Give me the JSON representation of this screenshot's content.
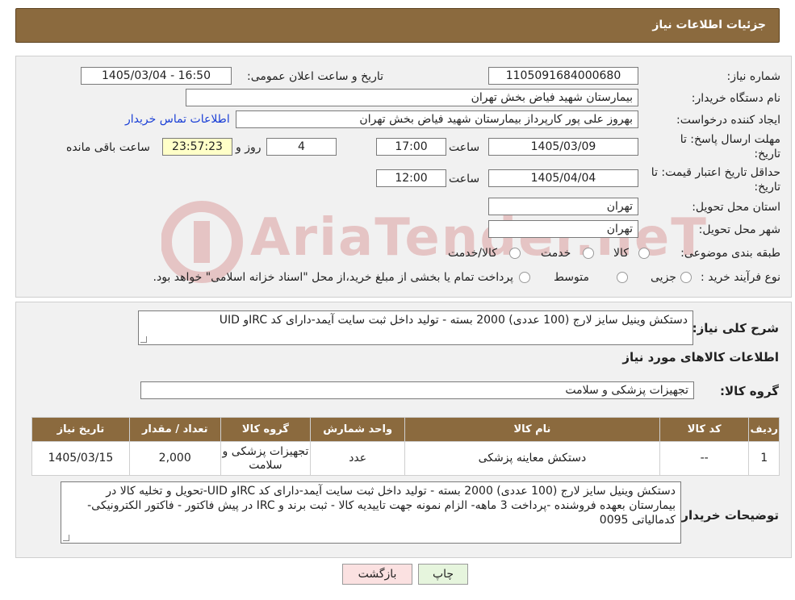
{
  "header": {
    "title": "جزئیات اطلاعات نیاز"
  },
  "form": {
    "need_number": {
      "label": "شماره نیاز:",
      "value": "1105091684000680"
    },
    "announce_datetime": {
      "label": "تاریخ و ساعت اعلان عمومی:",
      "value": "1405/03/04 - 16:50"
    },
    "buyer_org": {
      "label": "نام دستگاه خریدار:",
      "value": "بیمارستان شهید فیاض بخش تهران"
    },
    "requester": {
      "label": "ایجاد کننده درخواست:",
      "value": "بهروز علی پور کارپرداز بیمارستان شهید فیاض بخش تهران",
      "contact_link": "اطلاعات تماس خریدار"
    },
    "deadline": {
      "label_line1": "مهلت ارسال پاسخ: تا",
      "label_line2": "تاریخ:",
      "date": "1405/03/09",
      "time_label": "ساعت",
      "time": "17:00",
      "days": "4",
      "days_label": "روز و",
      "remaining": "23:57:23",
      "remaining_label": "ساعت باقی مانده"
    },
    "price_validity": {
      "label_line1": "حداقل تاریخ اعتبار قیمت: تا",
      "label_line2": "تاریخ:",
      "date": "1405/04/04",
      "time_label": "ساعت",
      "time": "12:00"
    },
    "province": {
      "label": "استان محل تحویل:",
      "value": "تهران"
    },
    "city": {
      "label": "شهر محل تحویل:",
      "value": "تهران"
    },
    "category": {
      "label": "طبقه بندی موضوعی:",
      "options": [
        "کالا",
        "خدمت",
        "کالا/خدمت"
      ]
    },
    "purchase_type": {
      "label": "نوع فرآیند خرید :",
      "options": [
        "جزیی",
        "متوسط"
      ],
      "note": "پرداخت تمام یا بخشی از مبلغ خرید،از محل \"اسناد خزانه اسلامی\" خواهد بود."
    }
  },
  "description": {
    "label": "شرح کلی نیاز:",
    "value": "دستکش وینیل سایز لارج (100 عددی) 2000 بسته - تولید داخل ثبت سایت آیمد-دارای کد IRCو UID"
  },
  "goods_info": {
    "title": "اطلاعات کالاهای مورد نیاز"
  },
  "goods_group": {
    "label": "گروه کالا:",
    "value": "تجهیزات پزشکی و سلامت"
  },
  "table": {
    "headers": [
      "ردیف",
      "کد کالا",
      "نام کالا",
      "واحد شمارش",
      "گروه کالا",
      "تعداد / مقدار",
      "تاریخ نیاز"
    ],
    "rows": [
      [
        "1",
        "--",
        "دستکش معاینه پزشکی",
        "عدد",
        "تجهیزات پزشکی و سلامت",
        "2,000",
        "1405/03/15"
      ]
    ]
  },
  "buyer_notes": {
    "label": "توضیحات خریدار:",
    "value": "دستکش وینیل سایز لارج (100 عددی) 2000 بسته - تولید داخل ثبت سایت آیمد-دارای کد IRCو UID-تحویل و تخلیه کالا در بیمارستان بعهده فروشنده -پرداخت 3 ماهه- الزام نمونه جهت تاییدیه کالا - ثبت برند و IRC در پیش فاکتور - فاکتور الکترونیکی- کدمالیاتی 0095"
  },
  "buttons": {
    "print": "چاپ",
    "back": "بازگشت"
  },
  "watermark": {
    "text": "AriaTender.neT"
  },
  "colors": {
    "header_bg": "#8b6a3e",
    "link": "#1a3fd6",
    "remaining_bg": "#ffffc8"
  }
}
